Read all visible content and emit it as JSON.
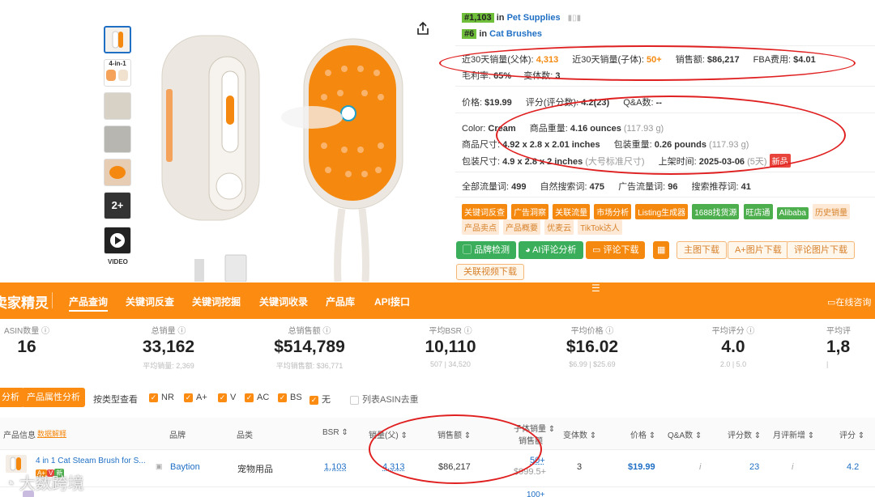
{
  "product": {
    "rank1_num": "#1,103",
    "rank1_in": "in",
    "rank1_cat": "Pet Supplies",
    "rank2_num": "#6",
    "rank2_in": "in",
    "rank2_cat": "Cat Brushes",
    "sales_parent_label": "近30天销量(父体):",
    "sales_parent": "4,313",
    "sales_child_label": "近30天销量(子体):",
    "sales_child": "50+",
    "revenue_label": "销售额:",
    "revenue": "$86,217",
    "fba_label": "FBA费用:",
    "fba": "$4.01",
    "margin_label": "毛利率:",
    "margin": "65%",
    "variants_label": "变体数:",
    "variants": "3",
    "price_label": "价格:",
    "price": "$19.99",
    "rating_label": "评分(评分数):",
    "rating": "4.2(23)",
    "qa_label": "Q&A数:",
    "qa": "--",
    "color_label": "Color:",
    "color": "Cream",
    "weight_label": "商品重量:",
    "weight": "4.16 ounces",
    "weight_g": "(117.93 g)",
    "dims_label": "商品尺寸:",
    "dims": "4.92 x 2.8 x 2.01 inches",
    "pkg_weight_label": "包装重量:",
    "pkg_weight": "0.26 pounds",
    "pkg_weight_g": "(117.93 g)",
    "pkg_dims_label": "包装尺寸:",
    "pkg_dims": "4.9 x 2.8 x 2 inches",
    "pkg_size_class": "(大号标准尺寸)",
    "listed_label": "上架时间:",
    "listed": "2025-03-06",
    "listed_days": "(5天)",
    "new_badge": "新品",
    "all_traffic_label": "全部流量词:",
    "all_traffic": "499",
    "organic_label": "自然搜索词:",
    "organic": "475",
    "ad_label": "广告流量词:",
    "ad": "96",
    "suggest_label": "搜索推荐词:",
    "suggest": "41",
    "video_label": "VIDEO",
    "thumb_more": "2+",
    "thumb_4in1": "4-in-1"
  },
  "tools": {
    "row1": [
      "关键词反查",
      "广告洞察",
      "关联流量",
      "市场分析",
      "Listing生成器",
      "1688找货源",
      "旺店通",
      "Alibaba",
      "历史销量"
    ],
    "row2": [
      "产品卖点",
      "产品概要",
      "优麦云",
      "TikTok达人"
    ],
    "buttons": [
      "品牌检测",
      "AI评论分析",
      "评论下载"
    ],
    "dl_buttons": [
      "主图下载",
      "A+图片下载",
      "评论图片下载"
    ],
    "video_dl": "关联视频下载"
  },
  "nav": {
    "logo": "卖家精灵",
    "items": [
      "产品查询",
      "关键词反查",
      "关键词挖掘",
      "关键词收录",
      "产品库",
      "API接口"
    ],
    "consult": "在线咨询"
  },
  "stats": [
    {
      "label": "ASIN数量",
      "value": "16",
      "sub": ""
    },
    {
      "label": "总销量",
      "value": "33,162",
      "sub": "平均销量: 2,369"
    },
    {
      "label": "总销售额",
      "value": "$514,789",
      "sub": "平均销售额: $36,771"
    },
    {
      "label": "平均BSR",
      "value": "10,110",
      "sub": "507 | 34,520"
    },
    {
      "label": "平均价格",
      "value": "$16.02",
      "sub": "$6.99 | $25.69"
    },
    {
      "label": "平均评分",
      "value": "4.0",
      "sub": "2.0 | 5.0"
    },
    {
      "label": "平均评",
      "value": "1,8",
      "sub": ""
    }
  ],
  "filters": {
    "btn1": "分析",
    "btn2": "产品属性分析",
    "view_label": "按类型查看",
    "types": [
      "NR",
      "A+",
      "V",
      "AC",
      "BS",
      "无"
    ],
    "dedupe": "列表ASIN去重"
  },
  "table": {
    "headers": [
      "产品信息",
      "数据解释",
      "品牌",
      "品类",
      "BSR",
      "销量(父)",
      "销售额",
      "子体销量",
      "销售额",
      "变体数",
      "价格",
      "Q&A数",
      "评分数",
      "月评新增",
      "评分"
    ],
    "row": {
      "title": "4 in 1 Cat Steam Brush for S...",
      "brand": "Baytion",
      "category": "宠物用品",
      "bsr": "1,103",
      "sales": "4,313",
      "revenue": "$86,217",
      "child_sales": "50+",
      "child_revenue": "$999.5+",
      "variants": "3",
      "price": "$19.99",
      "qa": "i",
      "reviews": "23",
      "monthly": "i",
      "rating": "4.2"
    },
    "next_row_partial": "100+"
  },
  "watermark": "大数跨境"
}
